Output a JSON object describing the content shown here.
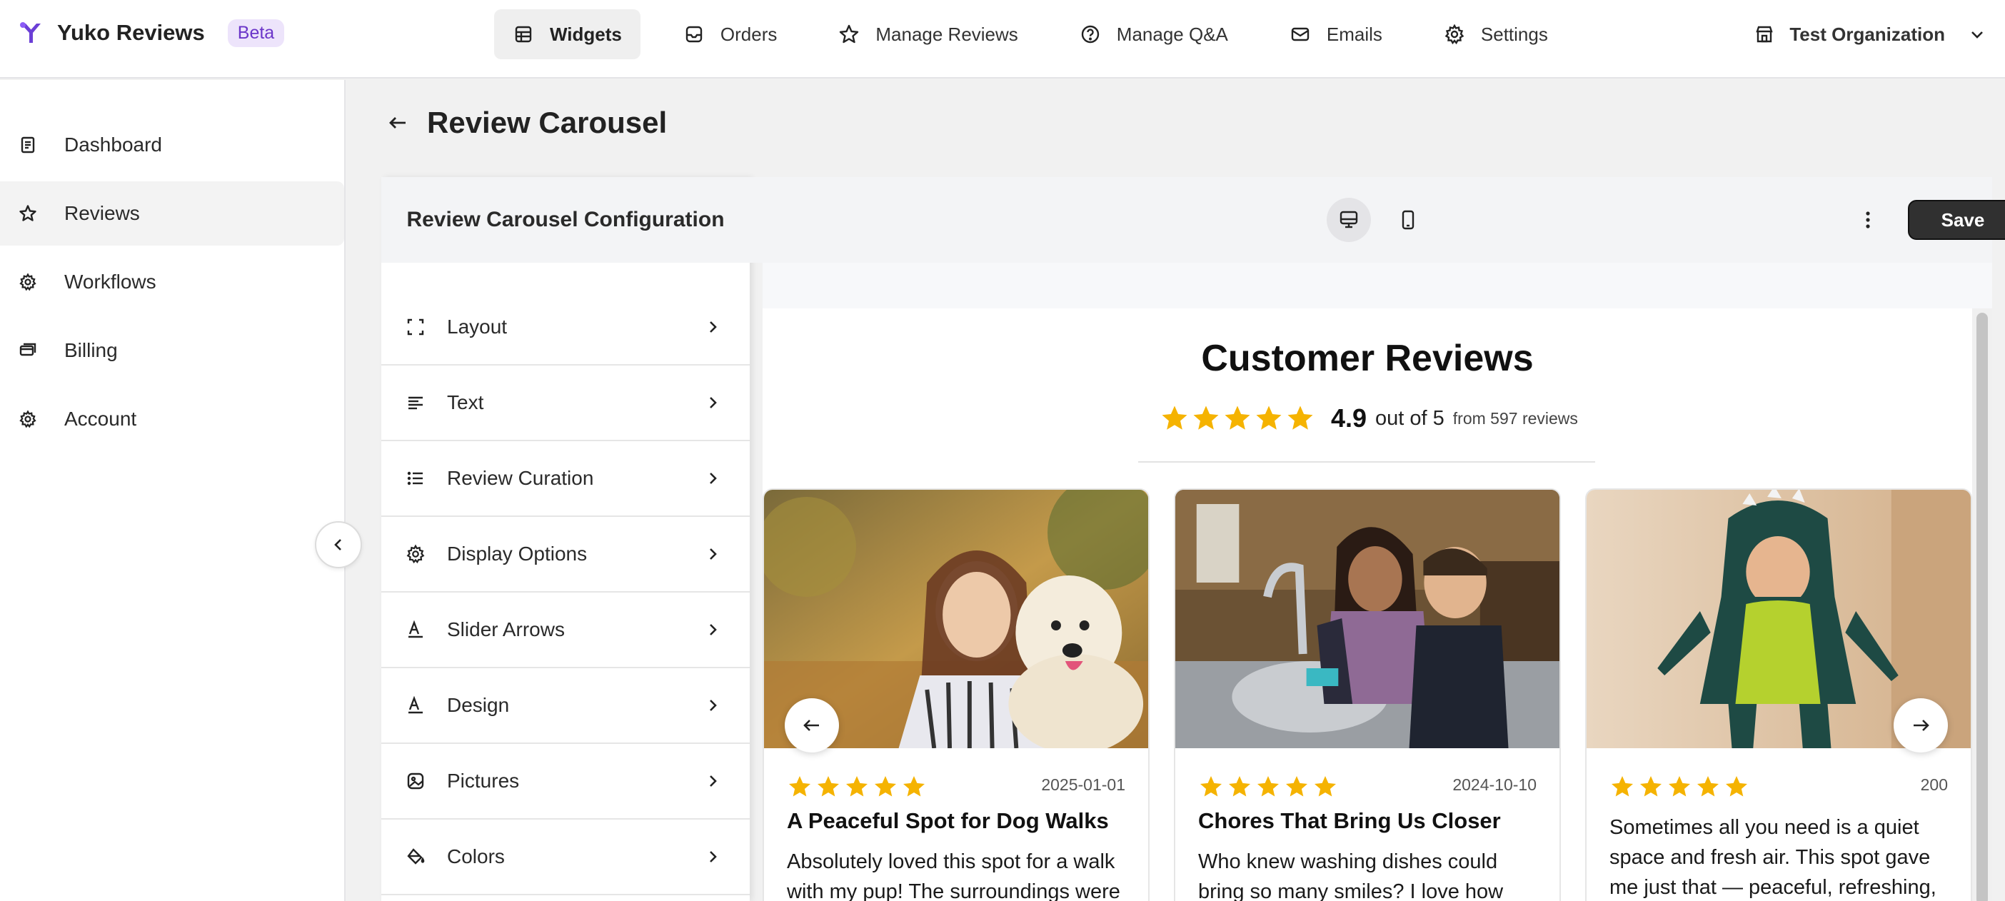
{
  "app": {
    "name": "Yuko Reviews",
    "badge": "Beta"
  },
  "topnav": {
    "items": [
      {
        "label": "Widgets",
        "icon": "widgets-icon"
      },
      {
        "label": "Orders",
        "icon": "inbox-icon"
      },
      {
        "label": "Manage Reviews",
        "icon": "star-icon"
      },
      {
        "label": "Manage Q&A",
        "icon": "question-icon"
      },
      {
        "label": "Emails",
        "icon": "mail-icon"
      },
      {
        "label": "Settings",
        "icon": "gear-icon"
      }
    ],
    "active": "Widgets"
  },
  "org": {
    "label": "Test Organization",
    "icon": "store-icon"
  },
  "sidebar": {
    "items": [
      {
        "label": "Dashboard",
        "icon": "dashboard-icon"
      },
      {
        "label": "Reviews",
        "icon": "star-icon"
      },
      {
        "label": "Workflows",
        "icon": "gear-icon"
      },
      {
        "label": "Billing",
        "icon": "billing-icon"
      },
      {
        "label": "Account",
        "icon": "gear-icon"
      }
    ],
    "active": "Reviews"
  },
  "page": {
    "title": "Review Carousel"
  },
  "config": {
    "title": "Review Carousel Configuration",
    "items": [
      {
        "label": "Layout",
        "icon": "layout-icon"
      },
      {
        "label": "Text",
        "icon": "text-align-icon"
      },
      {
        "label": "Review Curation",
        "icon": "list-icon"
      },
      {
        "label": "Display Options",
        "icon": "gear-icon"
      },
      {
        "label": "Slider Arrows",
        "icon": "font-icon"
      },
      {
        "label": "Design",
        "icon": "font-icon"
      },
      {
        "label": "Pictures",
        "icon": "image-icon"
      },
      {
        "label": "Colors",
        "icon": "paint-bucket-icon"
      }
    ]
  },
  "toolbar": {
    "save_label": "Save",
    "active_device": "desktop"
  },
  "widget": {
    "title": "Customer Reviews",
    "rating": "4.9",
    "out_of": "out of 5",
    "from": "from 597 reviews",
    "star_color": "#f5b301",
    "reviews": [
      {
        "date": "2025-01-01",
        "title": "A Peaceful Spot for Dog Walks",
        "body": "Absolutely loved this spot for a walk with my pup! The surroundings were",
        "stars": 5
      },
      {
        "date": "2024-10-10",
        "title": "Chores That Bring Us Closer",
        "body": "Who knew washing dishes could bring so many smiles? I love how we’ve",
        "stars": 5
      },
      {
        "date": "200",
        "title": "",
        "body": "Sometimes all you need is a quiet space and fresh air. This spot gave me just that — peaceful, refreshing,",
        "stars": 5
      }
    ]
  }
}
